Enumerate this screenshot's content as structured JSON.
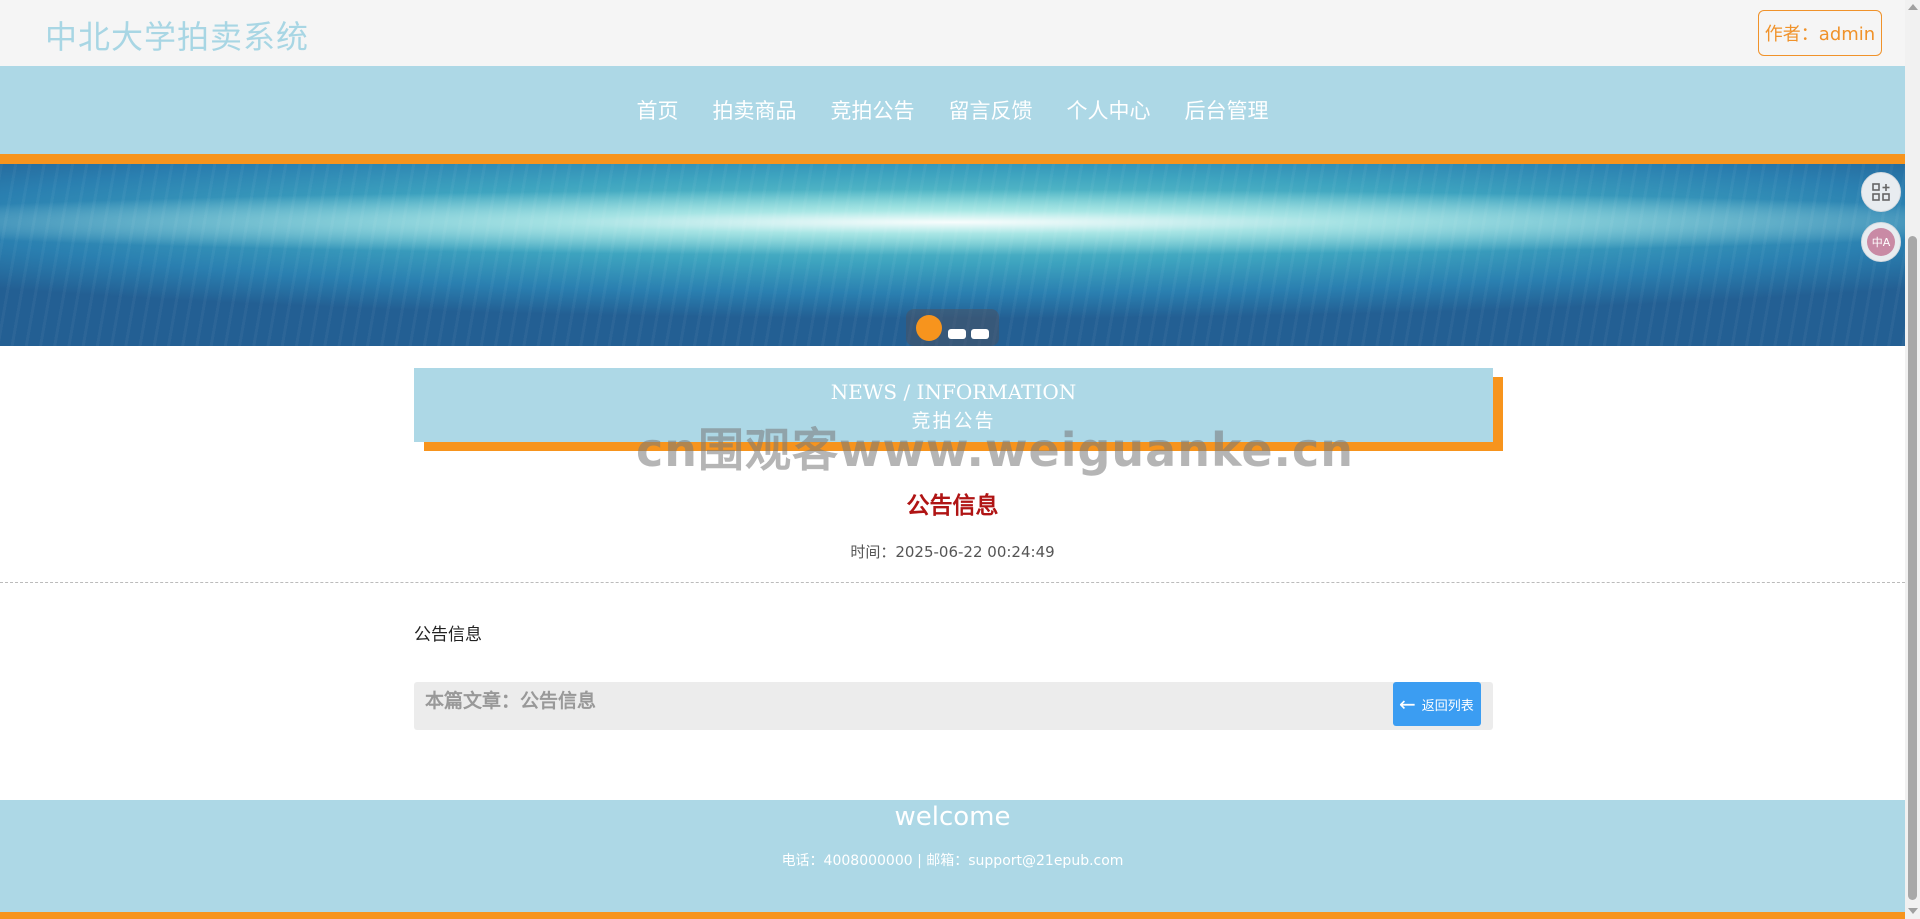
{
  "header": {
    "site_title": "中北大学拍卖系统",
    "author_label": "作者：admin"
  },
  "nav": {
    "items": [
      {
        "label": "首页"
      },
      {
        "label": "拍卖商品"
      },
      {
        "label": "竞拍公告"
      },
      {
        "label": "留言反馈"
      },
      {
        "label": "个人中心"
      },
      {
        "label": "后台管理"
      }
    ]
  },
  "banner": {
    "active_slide": 1,
    "slide_count": 3
  },
  "section": {
    "title_en": "NEWS / INFORMATION",
    "title_cn": "竞拍公告"
  },
  "watermark": "cn围观客www.weiguanke.cn",
  "article": {
    "title": "公告信息",
    "time": "时间：2025-06-22 00:24:49",
    "body": "公告信息",
    "ref_text": "本篇文章：公告信息",
    "back_label": "返回列表"
  },
  "footer": {
    "welcome": "welcome",
    "contact": "电话：4008000000 | 邮箱：support@21epub.com"
  },
  "floating": {
    "translate_label": "中A"
  },
  "colors": {
    "accent_orange": "#f7941d",
    "nav_blue": "#add8e6",
    "title_red": "#b01414",
    "button_blue": "#3b9df2"
  }
}
